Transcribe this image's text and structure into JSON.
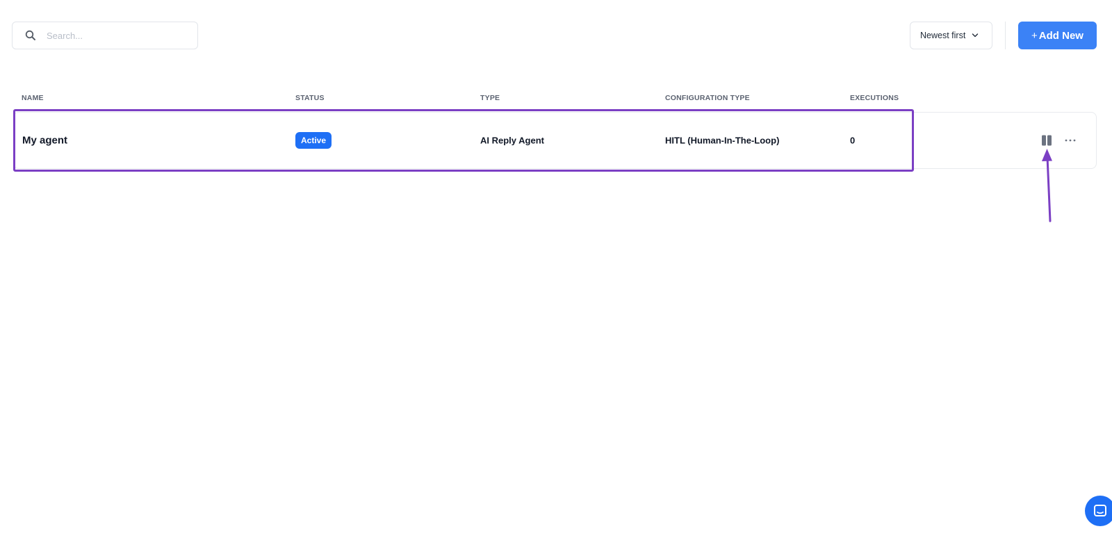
{
  "toolbar": {
    "search_placeholder": "Search...",
    "sort_label": "Newest first",
    "add_button_label": "Add New",
    "add_button_plus": "+"
  },
  "table": {
    "columns": [
      "NAME",
      "STATUS",
      "TYPE",
      "CONFIGURATION TYPE",
      "EXECUTIONS"
    ],
    "rows": [
      {
        "name": "My agent",
        "status": "Active",
        "type": "AI Reply Agent",
        "configuration_type": "HITL (Human-In-The-Loop)",
        "executions": "0"
      }
    ]
  },
  "icons": {
    "search": "search-icon",
    "sort": "chevron-down-icon",
    "pause": "pause-icon",
    "more": "more-horizontal-icon",
    "chat": "chat-icon"
  },
  "colors": {
    "primary": "#3b82f6",
    "badge": "#1e6ff5",
    "highlight": "#7b3fc4"
  }
}
